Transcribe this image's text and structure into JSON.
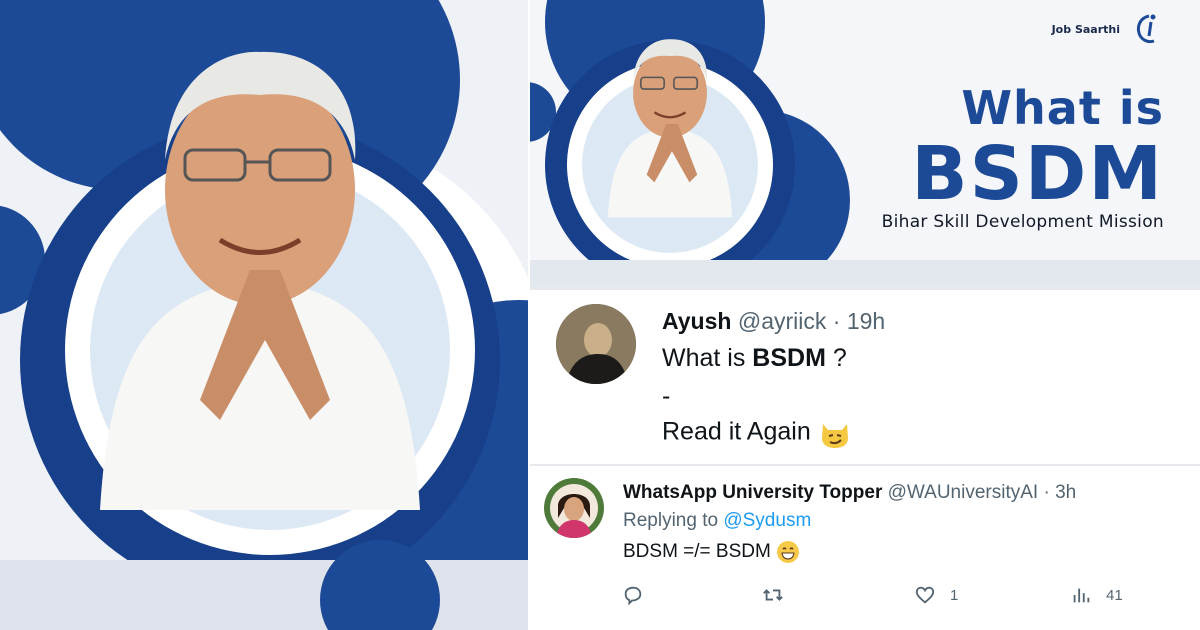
{
  "banner": {
    "brand_name": "Job Saarthi",
    "logo_icon": "job-saarthi-logo-icon",
    "title_line1": "What is",
    "title_line2": "BSDM",
    "subtitle": "Bihar Skill Development Mission",
    "colors": {
      "primary_blue": "#1d4a97",
      "dark_blue": "#173f8a",
      "background": "#f4f6fa"
    }
  },
  "tweets": [
    {
      "display_name": "Ayush",
      "handle": "@ayriick",
      "separator": "·",
      "time": "19h",
      "text_prefix": "What is ",
      "text_bold": "BSDM",
      "text_suffix": " ?",
      "text_line2": "-",
      "text_line3": "Read it Again",
      "emoji_icon": "smirking-cat-emoji"
    },
    {
      "display_name": "WhatsApp University Topper",
      "handle": "@WAUniversityAI",
      "separator": "·",
      "time": "3h",
      "replying_prefix": "Replying to ",
      "replying_to": "@Sydusm",
      "text": "BDSM =/= BSDM",
      "emoji_icon": "grinning-face-emoji",
      "actions": {
        "reply_icon": "reply-icon",
        "retweet_icon": "retweet-icon",
        "like_icon": "heart-icon",
        "like_count": "1",
        "views_icon": "views-icon",
        "views_count": "41"
      }
    }
  ]
}
